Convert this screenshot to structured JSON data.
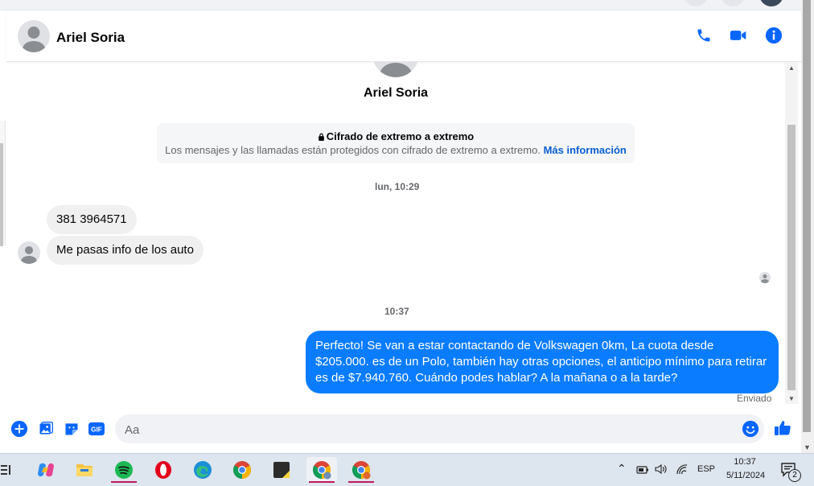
{
  "header": {
    "contact_name": "Ariel Soria"
  },
  "profile": {
    "name": "Ariel Soria"
  },
  "encryption_notice": {
    "title": "Cifrado de extremo a extremo",
    "body": "Los mensajes y las llamadas están protegidos con cifrado de extremo a extremo.",
    "link": "Más información"
  },
  "thread": {
    "timestamp_1": "lun, 10:29",
    "incoming": [
      {
        "text": "381 3964571"
      },
      {
        "text": "Me pasas info de los auto"
      }
    ],
    "timestamp_2": "10:37",
    "outgoing": [
      {
        "text": "Perfecto!  Se van a estar contactando de Volkswagen 0km, La cuota desde $205.000. es de un Polo, también hay otras opciones, el anticipo mínimo para retirar es de $7.940.760. Cuándo podes hablar? A la mañana o a la tarde?"
      }
    ],
    "status": "Enviado"
  },
  "composer": {
    "placeholder": "Aa",
    "value": ""
  },
  "taskbar": {
    "apps": [
      "copilot",
      "file-explorer",
      "spotify",
      "opera",
      "edge",
      "chrome",
      "sticky-notes",
      "chrome-profile-1",
      "chrome-profile-2"
    ],
    "language": "ESP",
    "time": "10:37",
    "date": "5/11/2024",
    "notification_count": "2"
  },
  "colors": {
    "accent": "#0a7cff",
    "icon_blue": "#0866ff",
    "incoming_bubble": "#f0f0f0"
  }
}
